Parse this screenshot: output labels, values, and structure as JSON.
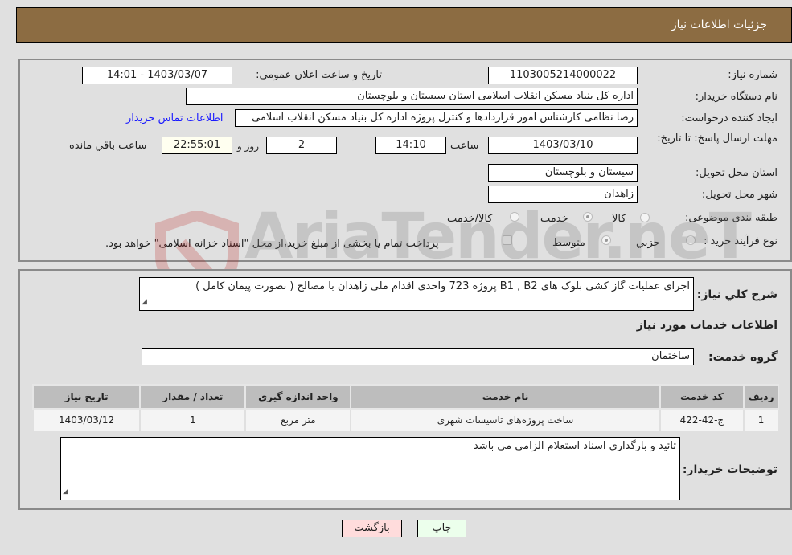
{
  "header": {
    "title": "جزئیات اطلاعات نیاز"
  },
  "form": {
    "need_number": {
      "label": "شماره نیاز:",
      "value": "1103005214000022"
    },
    "announce_datetime": {
      "label": "تاریخ و ساعت اعلان عمومي:",
      "value": "1403/03/07 - 14:01"
    },
    "buyer_org": {
      "label": "نام دستگاه خریدار:",
      "value": "اداره کل بنیاد مسکن انقلاب اسلامی استان سیستان و بلوچستان"
    },
    "requester": {
      "label": "ایجاد کننده درخواست:",
      "value": "رضا نظامی کارشناس امور قراردادها و کنترل پروژه اداره کل بنیاد مسکن انقلاب اسلامی",
      "contact_link": "اطلاعات تماس خریدار"
    },
    "deadline": {
      "label": "مهلت ارسال پاسخ: تا تاریخ:",
      "date": "1403/03/10",
      "time_label": "ساعت",
      "time": "14:10",
      "days": "2",
      "days_label": "روز و",
      "remaining": "22:55:01",
      "remaining_label": "ساعت باقي مانده"
    },
    "delivery_province": {
      "label": "استان محل تحویل:",
      "value": "سیستان و بلوچستان"
    },
    "delivery_city": {
      "label": "شهر محل تحویل:",
      "value": "زاهدان"
    },
    "category": {
      "label": "طبقه بندی موضوعی:",
      "options": [
        "کالا",
        "خدمت",
        "کالا/خدمت"
      ],
      "selected": "خدمت"
    },
    "purchase_type": {
      "label": "نوع فرآیند خرید :",
      "options": [
        "جزيي",
        "متوسط"
      ],
      "selected": "متوسط",
      "treasury_note": "پرداخت تمام یا بخشی از مبلغ خرید،از محل \"اسناد خزانه اسلامی\" خواهد بود."
    }
  },
  "details": {
    "description_label": "شرح کلي نیاز:",
    "description": "اجرای عملیات گاز کشی بلوک های  B1 , B2 پروژه 723 واحدی اقدام ملی زاهدان با مصالح ( بصورت پیمان کامل )",
    "services_heading": "اطلاعات خدمات مورد نیاز",
    "service_group_label": "گروه خدمت:",
    "service_group": "ساختمان",
    "table": {
      "headers": [
        "ردیف",
        "کد خدمت",
        "نام خدمت",
        "واحد اندازه گیری",
        "تعداد / مقدار",
        "تاریخ نیاز"
      ],
      "rows": [
        [
          "1",
          "ج-42-422",
          "ساخت پروژه‌های تاسیسات شهری",
          "متر مربع",
          "1",
          "1403/03/12"
        ]
      ]
    },
    "buyer_notes_label": "توضیحات خریدار:",
    "buyer_notes": "تائید و بارگذاری اسناد استعلام الزامی می باشد"
  },
  "buttons": {
    "print": "چاپ",
    "back": "بازگشت"
  },
  "watermark": {
    "text": "AriaTender.neT"
  },
  "colors": {
    "header_bg": "#8c6c42",
    "link": "#1a1aff",
    "back_btn": "#ffdcdc",
    "print_btn": "#ecffec"
  }
}
